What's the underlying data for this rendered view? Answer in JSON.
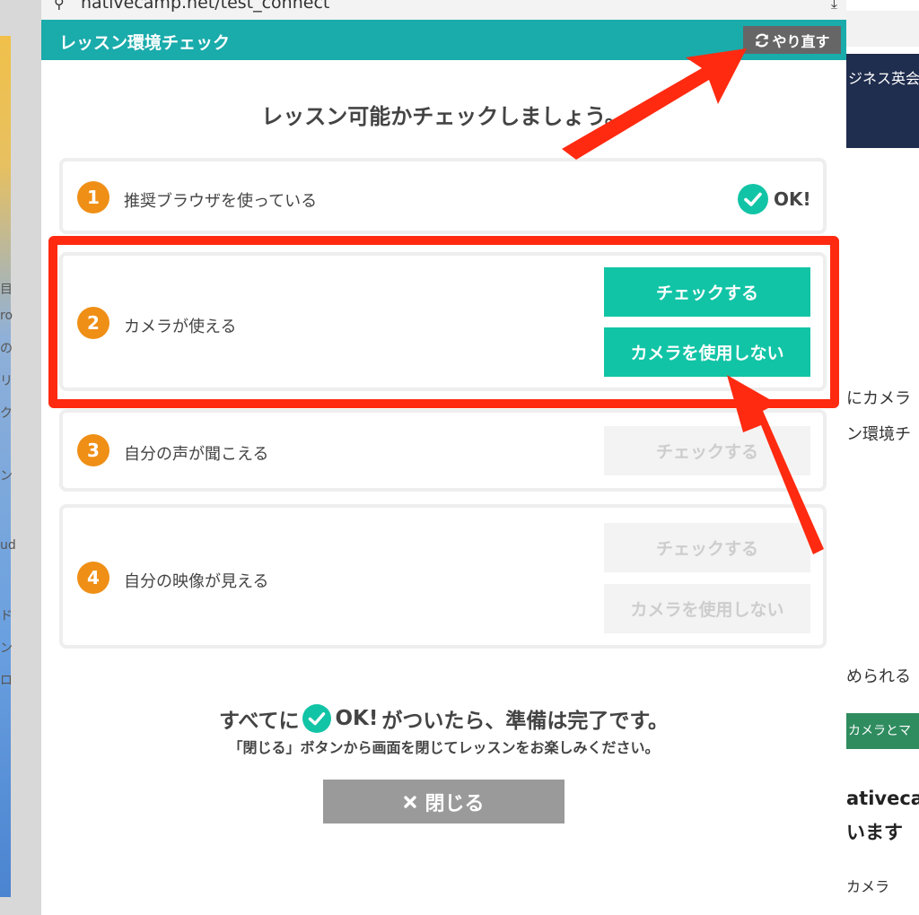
{
  "browser": {
    "url": "nativecamp.net/test_connect"
  },
  "popup": {
    "title": "レッスン環境チェック",
    "retry_label": "やり直す",
    "headline": "レッスン可能かチェックしましょう。",
    "steps": [
      {
        "number": "1",
        "label": "推奨ブラウザを使っている",
        "status": "OK!"
      },
      {
        "number": "2",
        "label": "カメラが使える",
        "check_label": "チェックする",
        "nocam_label": "カメラを使用しない"
      },
      {
        "number": "3",
        "label": "自分の声が聞こえる",
        "check_label": "チェックする"
      },
      {
        "number": "4",
        "label": "自分の映像が見える",
        "check_label": "チェックする",
        "nocam_label": "カメラを使用しない"
      }
    ],
    "footer": {
      "line1_before": "すべてに",
      "line1_ok": "OK!",
      "line1_after": "がついたら、準備は完了です。",
      "line2": "「閉じる」ボタンから画面を閉じてレッスンをお楽しみください。"
    },
    "close_label": "閉じる"
  },
  "background": {
    "right": {
      "nav_text": "ジネス英会",
      "text1": "にカメラ",
      "text2": "ン環境チ",
      "text3": "められる",
      "green_btn": "カメラとマ",
      "big1": "ativeca",
      "big2": "います",
      "bottom": "カメラ"
    },
    "left_fragments": [
      "目",
      "ro",
      "の",
      "リ",
      "ク",
      "ン",
      "ud",
      "ド",
      "ン",
      "ロ"
    ]
  },
  "colors": {
    "header_teal": "#1aabab",
    "button_green": "#12c4a6",
    "step_number_orange": "#ef8f16",
    "annotation_red": "#ff2a10"
  }
}
